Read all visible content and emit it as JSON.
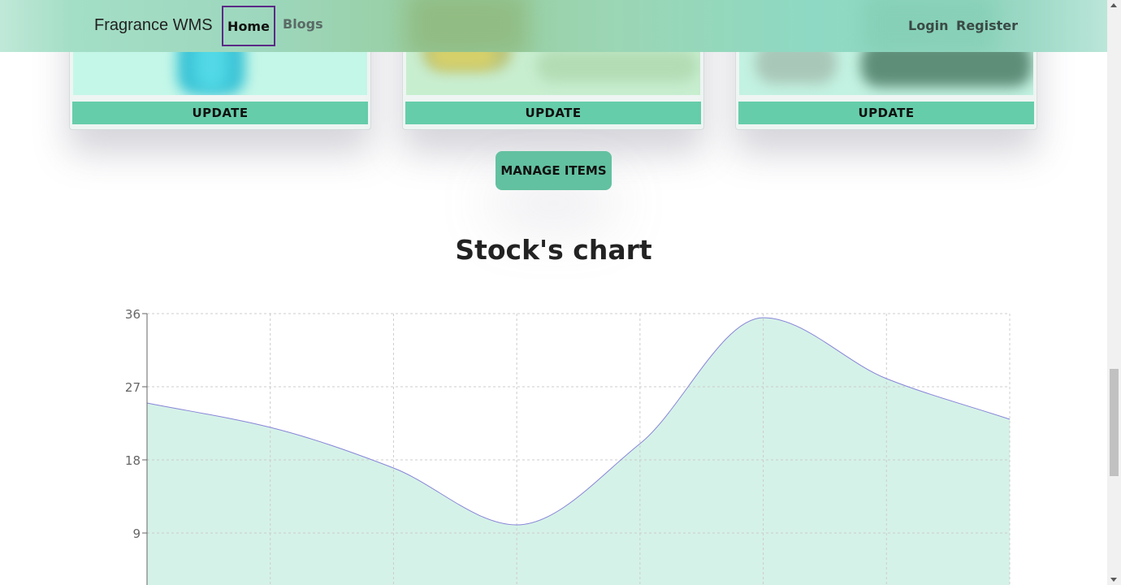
{
  "navbar": {
    "brand": "Fragrance WMS",
    "links": [
      "Home",
      "Blogs"
    ],
    "active": "Home",
    "auth": [
      "Login",
      "Register"
    ]
  },
  "cards": [
    {
      "button_label": "UPDATE"
    },
    {
      "button_label": "UPDATE"
    },
    {
      "button_label": "UPDATE"
    }
  ],
  "manage_button": "MANAGE ITEMS",
  "chart_title": "Stock's chart",
  "colors": {
    "accent": "#66cdaa",
    "area_fill": "#d5f2e8",
    "line": "#8884d8",
    "active_outline": "#5b2a86"
  },
  "chart_data": {
    "type": "area",
    "title": "Stock's chart",
    "values": [
      25,
      22,
      17,
      10,
      20,
      35.5,
      28,
      23
    ],
    "ylim": [
      0,
      36
    ],
    "yticks": [
      9,
      18,
      27,
      36
    ],
    "grid": true,
    "curve": "monotone"
  }
}
